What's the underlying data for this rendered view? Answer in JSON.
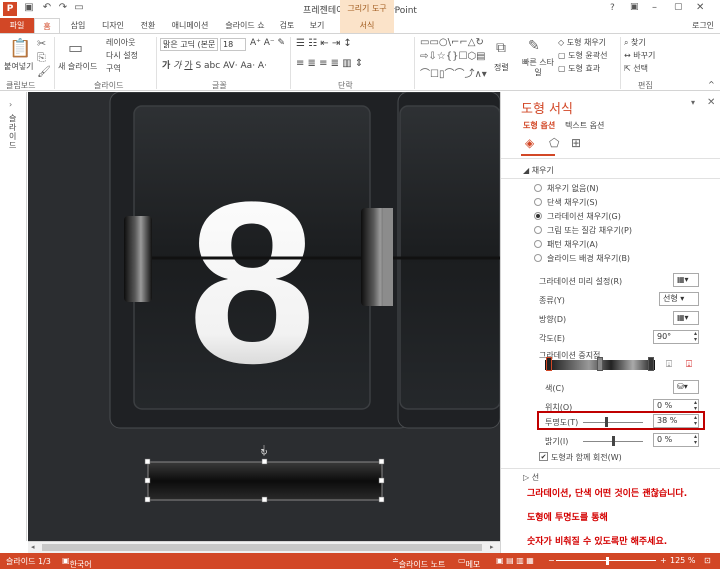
{
  "window": {
    "title": "프레젠테이션1 - PowerPoint",
    "tool_tab_title": "그리기 도구",
    "app_icon_letter": "P",
    "login": "로그인"
  },
  "tabs": [
    "파일",
    "홈",
    "삽입",
    "디자인",
    "전환",
    "애니메이션",
    "슬라이드 쇼",
    "검토",
    "보기",
    "서식"
  ],
  "ribbon": {
    "paste": "붙여넣기",
    "clipboard_group": "클립보드",
    "new_slide": "새 슬라이드",
    "layout": "레이아웃",
    "reset": "다시 설정",
    "section": "구역",
    "slides_group": "슬라이드",
    "font_name": "맑은 고딕 (본문",
    "font_size": "18",
    "font_group": "글꼴",
    "paragraph_group": "단락",
    "arrange": "정렬",
    "quick_styles": "빠른 스타일",
    "shape_fill": "도형 채우기",
    "shape_outline": "도형 윤곽선",
    "shape_effects": "도형 효과",
    "find": "찾기",
    "replace": "바꾸기",
    "select": "선택",
    "editing_group": "편집"
  },
  "left_strip_label": "슬라이드",
  "slide": {
    "digit": "8"
  },
  "pane": {
    "title": "도형 서식",
    "tab_shape": "도형 옵션",
    "tab_text": "텍스트 옵션",
    "fill_section": "채우기",
    "fill_options": [
      {
        "label": "채우기 없음(N)",
        "selected": false
      },
      {
        "label": "단색 채우기(S)",
        "selected": false
      },
      {
        "label": "그라데이션 채우기(G)",
        "selected": true
      },
      {
        "label": "그림 또는 질감 채우기(P)",
        "selected": false
      },
      {
        "label": "패턴 채우기(A)",
        "selected": false
      },
      {
        "label": "슬라이드 배경 채우기(B)",
        "selected": false
      }
    ],
    "preset_label": "그라데이션 미리 설정(R)",
    "type_label": "종류(Y)",
    "type_value": "선형",
    "direction_label": "방향(D)",
    "angle_label": "각도(E)",
    "angle_value": "90°",
    "stops_label": "그라데이션 중지점",
    "color_label": "색(C)",
    "position_label": "위치(O)",
    "position_value": "0 %",
    "transparency_label": "투명도(T)",
    "transparency_value": "38 %",
    "transparency_fraction": 0.38,
    "brightness_label": "밝기(I)",
    "brightness_value": "0 %",
    "rotate_label": "도형과 함께 회전(W)",
    "line_section": "선",
    "annotations": [
      "그라데이션, 단색 어떤 것이든 괜찮습니다.",
      "도형에 투명도를 통해",
      "숫자가 비춰질 수 있도록만 해주세요."
    ],
    "highlight_color": "#c00000"
  },
  "status": {
    "slide_count": "슬라이드 1/3",
    "language": "한국어",
    "notes": "슬라이드 노트",
    "comments": "메모",
    "zoom": "125 %"
  },
  "colors": {
    "accent": "#d24726",
    "accent_light": "#fbe3c9"
  }
}
